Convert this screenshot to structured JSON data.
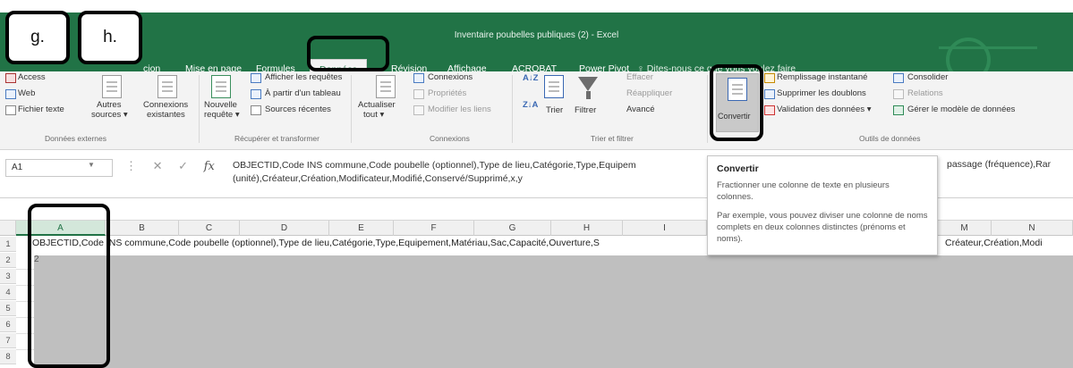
{
  "window": {
    "title": "Inventaire poubelles publiques (2) - Excel"
  },
  "annotations": {
    "label_g": "g.",
    "label_h": "h."
  },
  "tabs": [
    {
      "label": "cion"
    },
    {
      "label": "Mise en page"
    },
    {
      "label": "Formules"
    },
    {
      "label": "Données",
      "active": true
    },
    {
      "label": "Révision"
    },
    {
      "label": "Affichage"
    },
    {
      "label": "ACROBAT"
    },
    {
      "label": "Power Pivot"
    }
  ],
  "tell_me": "Dites-nous ce que vous voulez faire",
  "ribbon": {
    "external": {
      "access": "Access",
      "web": "Web",
      "text_file": "Fichier texte",
      "other_1": "Autres",
      "other_2": "sources ▾",
      "existing_1": "Connexions",
      "existing_2": "existantes",
      "group_label": "Données externes"
    },
    "get_transform": {
      "new_query_1": "Nouvelle",
      "new_query_2": "requête ▾",
      "show_queries": "Afficher les requêtes",
      "from_table": "À partir d'un tableau",
      "recent_sources": "Sources récentes",
      "group_label": "Récupérer et transformer"
    },
    "connections": {
      "refresh_1": "Actualiser",
      "refresh_2": "tout ▾",
      "connections": "Connexions",
      "properties": "Propriétés",
      "edit_links": "Modifier les liens",
      "group_label": "Connexions"
    },
    "sort_filter": {
      "sort": "Trier",
      "filter": "Filtrer",
      "clear": "Effacer",
      "reapply": "Réappliquer",
      "advanced": "Avancé",
      "group_label": "Trier et filtrer"
    },
    "data_tools": {
      "convert": "Convertir",
      "flash_fill": "Remplissage instantané",
      "remove_dupes": "Supprimer les doublons",
      "validation": "Validation des données ▾",
      "consolidate": "Consolider",
      "relations": "Relations",
      "data_model": "Gérer le modèle de données",
      "group_label": "Outils de données"
    }
  },
  "formula_bar": {
    "name_box": "A1",
    "fx": "fx",
    "content": "OBJECTID,Code INS commune,Code poubelle (optionnel),Type de lieu,Catégorie,Type,Equipem",
    "content_line2": "(unité),Créateur,Création,Modificateur,Modifié,Conservé/Supprimé,x,y",
    "content_tail": "passage (fréquence),Rar"
  },
  "tooltip": {
    "title": "Convertir",
    "p1": "Fractionner une colonne de texte en plusieurs colonnes.",
    "p2": "Par exemple, vous pouvez diviser une colonne de noms complets en deux colonnes distinctes (prénoms et noms)."
  },
  "grid": {
    "columns": [
      "A",
      "B",
      "C",
      "D",
      "E",
      "F",
      "G",
      "H",
      "I",
      "M",
      "N"
    ],
    "rows": [
      "1",
      "2",
      "3",
      "4",
      "5",
      "6",
      "7",
      "8"
    ],
    "row1_text": "OBJECTID,Code INS commune,Code poubelle (optionnel),Type de lieu,Catégorie,Type,Equipement,Matériau,Sac,Capacité,Ouverture,S",
    "row1_tail": "Créateur,Création,Modi",
    "a2": "2"
  }
}
